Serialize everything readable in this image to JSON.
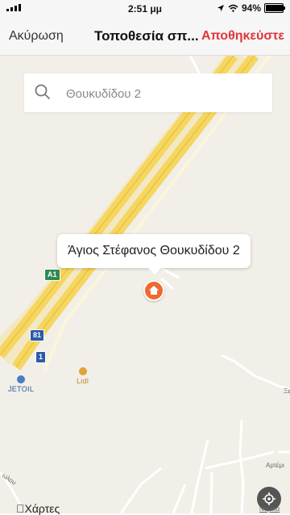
{
  "status_bar": {
    "time": "2:51 μμ",
    "battery": "94%",
    "battery_level": 0.94
  },
  "nav": {
    "cancel_label": "Ακύρωση",
    "title": "Τοποθεσία σπ...",
    "save_label": "Αποθηκεύστε"
  },
  "search": {
    "placeholder": "Θουκυδίδου 2"
  },
  "map": {
    "callout_text": "Άγιος Στέφανος Θουκυδίδου 2",
    "route_badges": [
      "A1",
      "81",
      "1"
    ],
    "pois": {
      "jetoil": "JETOIL",
      "lidl": "Lidl"
    },
    "street_labels": [
      "Αρτέμι",
      "Ξε",
      "ωλου"
    ],
    "maps_logo": "Χάρτες",
    "legal_label": "Νομικά"
  },
  "colors": {
    "accent_save": "#e0353b",
    "pin": "#ef6a2f",
    "motorway": "#f7d55e"
  },
  "icons": [
    "search-icon",
    "home-icon",
    "locate-icon",
    "apple-icon",
    "location-arrow-icon",
    "wifi-icon"
  ]
}
